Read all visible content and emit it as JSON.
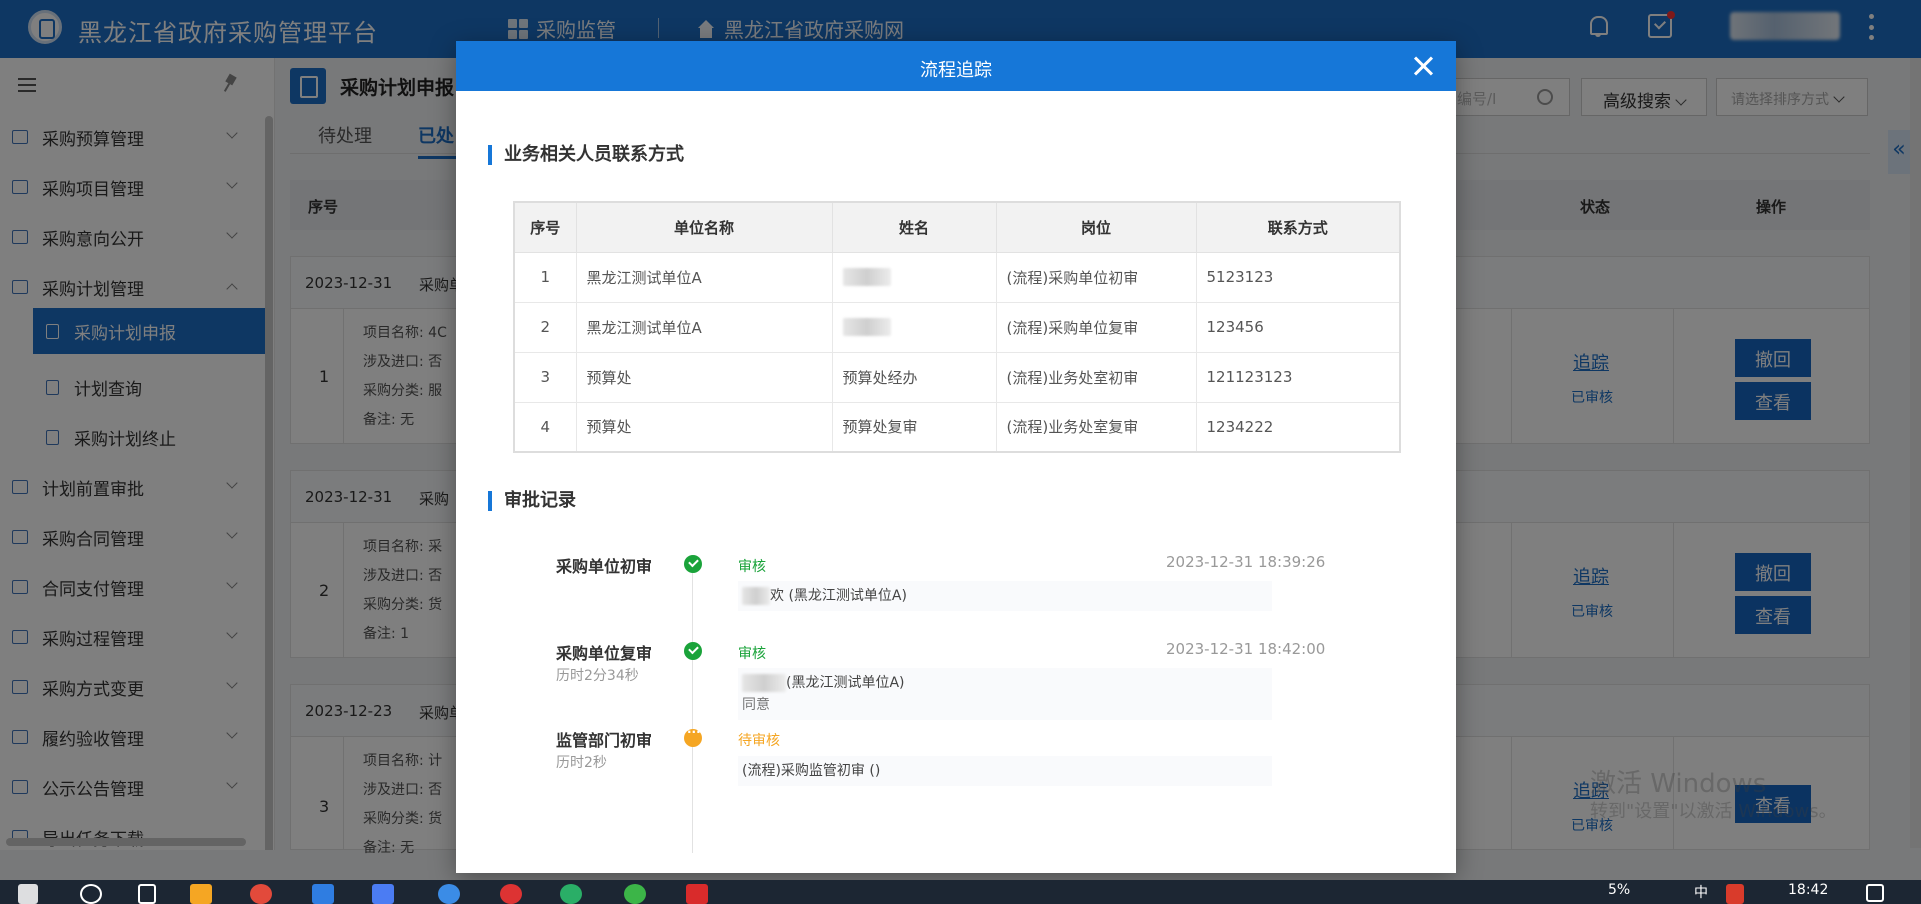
{
  "header": {
    "app_title": "黑龙江省政府采购管理平台",
    "nav": [
      {
        "label": "采购监管"
      },
      {
        "label": "黑龙江省政府采购网"
      }
    ]
  },
  "sidebar": {
    "items": [
      {
        "label": "采购预算管理",
        "icon": "budget-icon"
      },
      {
        "label": "采购项目管理",
        "icon": "project-icon"
      },
      {
        "label": "采购意向公开",
        "icon": "intent-icon"
      },
      {
        "label": "采购计划管理",
        "icon": "plan-icon"
      },
      {
        "label": "采购计划申报",
        "icon": "plan-report-icon"
      },
      {
        "label": "计划查询",
        "icon": "plan-query-icon"
      },
      {
        "label": "采购计划终止",
        "icon": "plan-stop-icon"
      },
      {
        "label": "计划前置审批",
        "icon": "pre-approval-icon"
      },
      {
        "label": "采购合同管理",
        "icon": "contract-icon"
      },
      {
        "label": "合同支付管理",
        "icon": "payment-icon"
      },
      {
        "label": "采购过程管理",
        "icon": "process-icon"
      },
      {
        "label": "采购方式变更",
        "icon": "method-change-icon"
      },
      {
        "label": "履约验收管理",
        "icon": "acceptance-icon"
      },
      {
        "label": "公示公告管理",
        "icon": "notice-icon"
      },
      {
        "label": "导出任务下载",
        "icon": "export-icon"
      }
    ]
  },
  "main": {
    "page_title": "采购计划申报",
    "tabs": [
      {
        "label": "待处理"
      },
      {
        "label": "已处"
      }
    ],
    "search_placeholder": "编号/I",
    "advanced_search": "高级搜索",
    "sort_placeholder": "请选择排序方式",
    "columns": {
      "seq": "序号",
      "status": "状态",
      "actions": "操作"
    },
    "records": [
      {
        "date": "2023-12-31",
        "prefix": "采购单",
        "idx": "1",
        "meta": [
          "项目名称: 4C",
          "涉及进口: 否",
          "采购分类: 服",
          "备注: 无"
        ],
        "track": "追踪",
        "status": "已审核",
        "btn1": "撤回",
        "btn2": "查看"
      },
      {
        "date": "2023-12-31",
        "prefix": "采购",
        "idx": "2",
        "meta": [
          "项目名称: 采",
          "涉及进口: 否",
          "采购分类: 货",
          "备注: 1"
        ],
        "track": "追踪",
        "status": "已审核",
        "btn1": "撤回",
        "btn2": "查看"
      },
      {
        "date": "2023-12-23",
        "prefix": "采购单",
        "idx": "3",
        "meta": [
          "项目名称: 计",
          "涉及进口: 否",
          "采购分类: 货",
          "备注: 无"
        ],
        "track": "追踪",
        "status": "已审核",
        "btn2": "查看"
      }
    ],
    "watermark": [
      "激活 Windows",
      "转到\"设置\"以激活 Windows。"
    ]
  },
  "modal": {
    "title": "流程追踪",
    "contacts_title": "业务相关人员联系方式",
    "contacts_headers": [
      "序号",
      "单位名称",
      "姓名",
      "岗位",
      "联系方式"
    ],
    "contacts": [
      {
        "no": "1",
        "unit": "黑龙江测试单位A",
        "name": "",
        "post": "(流程)采购单位初审",
        "phone": "5123123"
      },
      {
        "no": "2",
        "unit": "黑龙江测试单位A",
        "name": "",
        "post": "(流程)采购单位复审",
        "phone": "123456"
      },
      {
        "no": "3",
        "unit": "预算处",
        "name": "预算处经办",
        "post": "(流程)业务处室初审",
        "phone": "121123123"
      },
      {
        "no": "4",
        "unit": "预算处",
        "name": "预算处复审",
        "post": "(流程)业务处室复审",
        "phone": "1234222"
      }
    ],
    "approval_title": "审批记录",
    "approvals": [
      {
        "step": "采购单位初审",
        "duration": "",
        "result": "审核",
        "time": "2023-12-31 18:39:26",
        "person": "欢 (黑龙江测试单位A)",
        "comment": ""
      },
      {
        "step": "采购单位复审",
        "duration": "历时2分34秒",
        "result": "审核",
        "time": "2023-12-31 18:42:00",
        "person": "(黑龙江测试单位A)",
        "comment": "同意"
      },
      {
        "step": "监管部门初审",
        "duration": "历时2秒",
        "result": "待审核",
        "time": "",
        "person": "(流程)采购监管初审 ()",
        "comment": ""
      }
    ]
  },
  "taskbar": {
    "battery": "5%",
    "clock": "18:42",
    "ime": "中"
  }
}
